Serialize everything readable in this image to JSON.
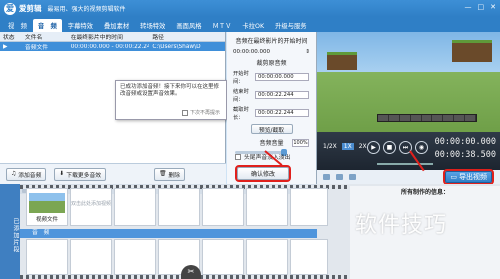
{
  "app": {
    "name": "爱剪辑",
    "slogan": "最易用、强大的视频剪辑软件"
  },
  "window_buttons": [
    "—",
    "□",
    "✕"
  ],
  "tabs": [
    {
      "label": "视　频",
      "active": false
    },
    {
      "label": "音　频",
      "active": true
    },
    {
      "label": "字幕特效",
      "active": false
    },
    {
      "label": "叠加素材",
      "active": false
    },
    {
      "label": "转场特效",
      "active": false
    },
    {
      "label": "画面风格",
      "active": false
    },
    {
      "label": "ＭＴＶ",
      "active": false
    },
    {
      "label": "卡拉OK",
      "active": false
    },
    {
      "label": "升级与服务",
      "active": false
    }
  ],
  "table": {
    "headers": [
      "状态",
      "文件名",
      "在最终影片中的时间",
      "路径"
    ],
    "rows": [
      {
        "status": "▶",
        "name": "音频文件",
        "time": "00:00:00.000 - 00:00:22.244",
        "path": "C:\\Users\\Shaw\\D"
      }
    ]
  },
  "popup": {
    "message": "已成功添加音频！接下来你可以在这里修改音频或设置声音效果。",
    "checkbox": "下次不再提示"
  },
  "left_buttons": {
    "add_audio": "添加音频",
    "download_music": "下载更多音效",
    "delete": "删除"
  },
  "mid": {
    "section_start": "音频在最终影片的开始时间",
    "start_value": "00:00:00.000",
    "section_clip": "裁剪原音频",
    "field_start_label": "开始时间：",
    "field_start": "00:00:00.000",
    "field_end_label": "结束时间：",
    "field_end": "00:00:22.244",
    "field_len_label": "截取时长：",
    "field_len": "00:00:22.244",
    "preview_btn": "预览/截取",
    "volume_label": "音频音量",
    "volume_pct": "100%",
    "volume_level": 1.0,
    "fade_label": "头尾声音淡入淡出",
    "confirm": "确认修改"
  },
  "player": {
    "speeds": [
      "1/2X",
      "1X",
      "2X"
    ],
    "active_speed": "1X",
    "time_current": "00:00:00.000",
    "time_total": "00:00:38.500"
  },
  "export_button": "导出视频",
  "timeline": {
    "side_label": "已添加片段",
    "clip_label": "视频文件",
    "drop_hint": "双击此处添加视频",
    "audio_label": "音　频"
  },
  "made_info": {
    "title": "所有制作的信息："
  },
  "watermark": "软件技巧",
  "colors": {
    "accent": "#2f7fc6",
    "highlight": "#e0201c",
    "selected_row": "#3f8fd9"
  }
}
